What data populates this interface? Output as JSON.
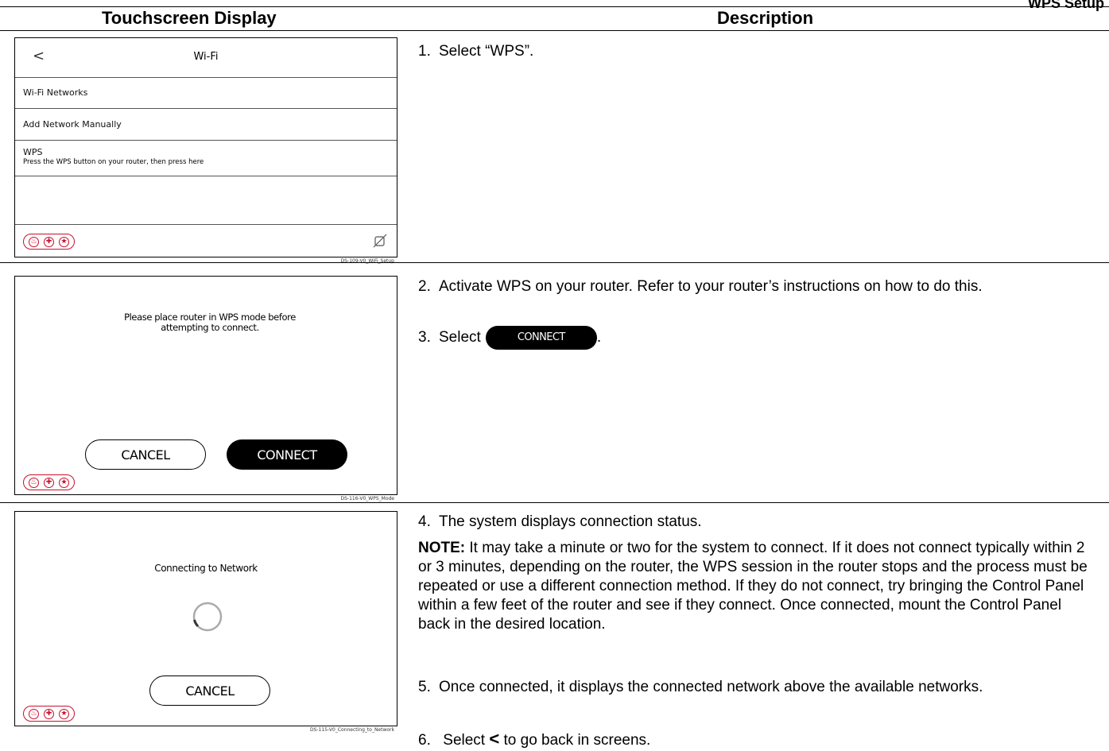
{
  "header": {
    "title": "WPS Setup"
  },
  "columns": {
    "display": "Touchscreen Display",
    "description": "Description"
  },
  "screen1": {
    "back_glyph": "<",
    "title": "Wi-Fi",
    "items": [
      {
        "label": "Wi-Fi Networks"
      },
      {
        "label": "Add Network Manually"
      },
      {
        "label": "WPS",
        "sublabel": "Press the WPS button on your router, then press here"
      }
    ],
    "caption": "DS-109-V0_WiFi_Setup"
  },
  "screen2": {
    "message": "Please place router in WPS mode before attempting to connect.",
    "cancel_label": "CANCEL",
    "connect_label": "CONNECT",
    "caption": "DS-116-V0_WPS_Mode"
  },
  "screen3": {
    "message": "Connecting to Network",
    "cancel_label": "CANCEL",
    "caption": "DS-115-V0_Connecting_to_Network"
  },
  "steps": {
    "s1_num": "1.",
    "s1": "Select “WPS”.",
    "s2_num": "2.",
    "s2": "Activate WPS on your router.  Refer to your router’s instructions on how to do this.",
    "s3_num": "3.",
    "s3_pre": "Select",
    "s3_button": "CONNECT",
    "s3_post": ".",
    "s4_num": "4.",
    "s4": "The system displays connection status.",
    "note_label": "NOTE:",
    "note": "It may take a minute or two for the system to connect.  If it does not connect typically within 2 or 3 minutes, depending on the router, the WPS session in the router stops and the process must be repeated or use a different connection method.  If they do not connect, try bringing the Control Panel within a few feet of the router and see if they connect.  Once connected, mount the Control Panel back in the desired location.",
    "s5_num": "5.",
    "s5": "Once connected, it displays the connected network above the available networks.",
    "s6_num": "6.",
    "s6_pre": "Select",
    "s6_glyph": "<",
    "s6_post": "to go back in screens."
  },
  "colors": {
    "emergency": "#c8102e",
    "ink": "#000000"
  },
  "icons": [
    "back-chevron-icon",
    "fire-icon",
    "medical-icon",
    "police-icon",
    "wifi-off-icon",
    "loading-spinner-icon"
  ]
}
